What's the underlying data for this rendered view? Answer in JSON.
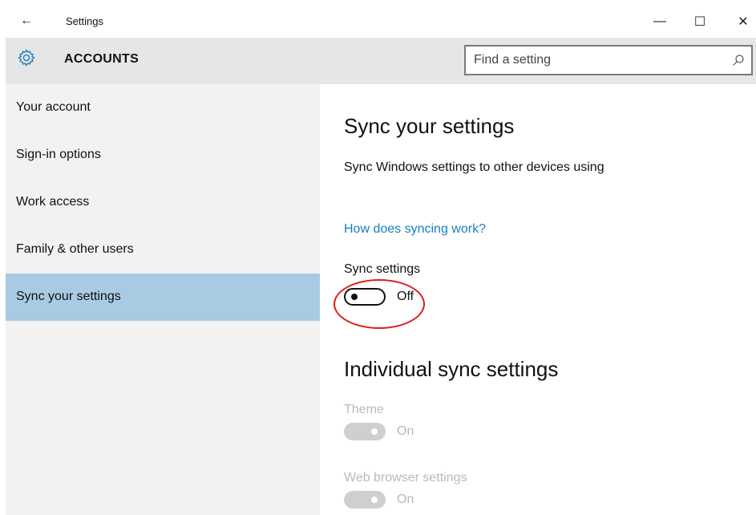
{
  "window": {
    "title": "Settings",
    "minimize": "—",
    "maximize": "☐",
    "close": "✕"
  },
  "header": {
    "section": "ACCOUNTS",
    "search_placeholder": "Find a setting"
  },
  "sidebar": {
    "items": [
      {
        "label": "Your account"
      },
      {
        "label": "Sign-in options"
      },
      {
        "label": "Work access"
      },
      {
        "label": "Family & other users"
      },
      {
        "label": "Sync your settings",
        "selected": true
      }
    ]
  },
  "main": {
    "title": "Sync your settings",
    "description": "Sync Windows settings to other devices using",
    "help_link": "How does syncing work?",
    "sync_settings": {
      "label": "Sync settings",
      "state": "Off"
    },
    "individual_title": "Individual sync settings",
    "individual": [
      {
        "label": "Theme",
        "state": "On"
      },
      {
        "label": "Web browser settings",
        "state": "On"
      }
    ]
  },
  "colors": {
    "accent": "#1a7ec2",
    "selected_nav": "#a8cbe3",
    "highlight_circle": "#e01b1b",
    "disabled_text": "#b9b9b9"
  },
  "icons": {
    "back": "back-arrow-icon",
    "section": "gear-icon",
    "search": "search-icon"
  }
}
